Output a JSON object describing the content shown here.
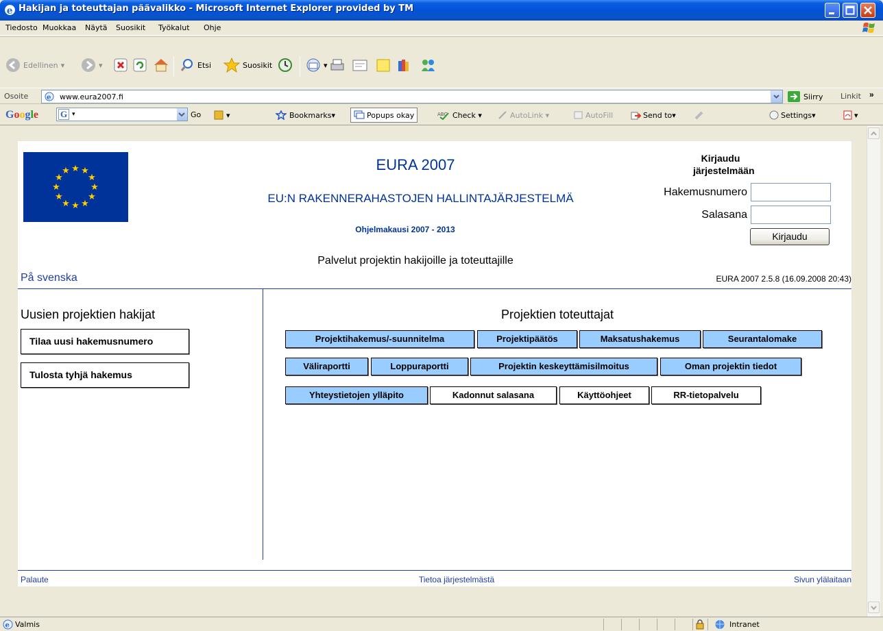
{
  "window": {
    "title": "Hakijan ja toteuttajan päävalikko - Microsoft Internet Explorer provided by TM"
  },
  "menu": {
    "items": [
      "Tiedosto",
      "Muokkaa",
      "Näytä",
      "Suosikit",
      "Työkalut",
      "Ohje"
    ]
  },
  "toolbar": {
    "back_label": "Edellinen",
    "search_label": "Etsi",
    "favorites_label": "Suosikit"
  },
  "address": {
    "label": "Osoite",
    "url": "www.eura2007.fi",
    "go_label": "Siirry",
    "links_label": "Linkit",
    "links_more": "»"
  },
  "google": {
    "logo": "Google",
    "search_value": "",
    "go_label": "Go",
    "bookmarks_label": "Bookmarks",
    "popups_label": "Popups okay",
    "check_label": "Check",
    "autolink_label": "AutoLink",
    "autofill_label": "AutoFill",
    "sendto_label": "Send to",
    "settings_label": "Settings"
  },
  "page": {
    "title": "EURA 2007",
    "subtitle": "EU:N RAKENNERAHASTOJEN HALLINTAJÄRJESTELMÄ",
    "period": "Ohjelmakausi 2007 - 2013",
    "services_title": "Palvelut projektin hakijoille ja toteuttajille",
    "language_link": "På svenska",
    "version": "EURA 2007 2.5.8 (16.09.2008 20:43)",
    "login": {
      "title_line1": "Kirjaudu",
      "title_line2": "järjestelmään",
      "application_number_label": "Hakemusnumero",
      "application_number_value": "",
      "password_label": "Salasana",
      "password_value": "",
      "submit_label": "Kirjaudu"
    },
    "new_applicants": {
      "title": "Uusien projektien hakijat",
      "buttons": [
        "Tilaa uusi hakemusnumero",
        "Tulosta tyhjä hakemus"
      ]
    },
    "implementers": {
      "title": "Projektien toteuttajat",
      "row1": [
        "Projektihakemus/-suunnitelma",
        "Projektipäätös",
        "Maksatushakemus",
        "Seurantalomake"
      ],
      "row2": [
        "Väliraportti",
        "Loppuraportti",
        "Projektin keskeyttämisilmoitus",
        "Oman projektin tiedot"
      ],
      "row3": [
        "Yhteystietojen ylläpito",
        "Kadonnut salasana",
        "Käyttöohjeet",
        "RR-tietopalvelu"
      ]
    },
    "footer": {
      "feedback": "Palaute",
      "about": "Tietoa järjestelmästä",
      "top": "Sivun ylälaitaan"
    }
  },
  "status": {
    "text": "Valmis",
    "zone": "Intranet"
  },
  "colors": {
    "link_blue": "#1f3ca6",
    "title_blue": "#003399",
    "button_blue": "#99ccff",
    "eu_flag": "#003399",
    "eu_star": "#ffcc00"
  }
}
